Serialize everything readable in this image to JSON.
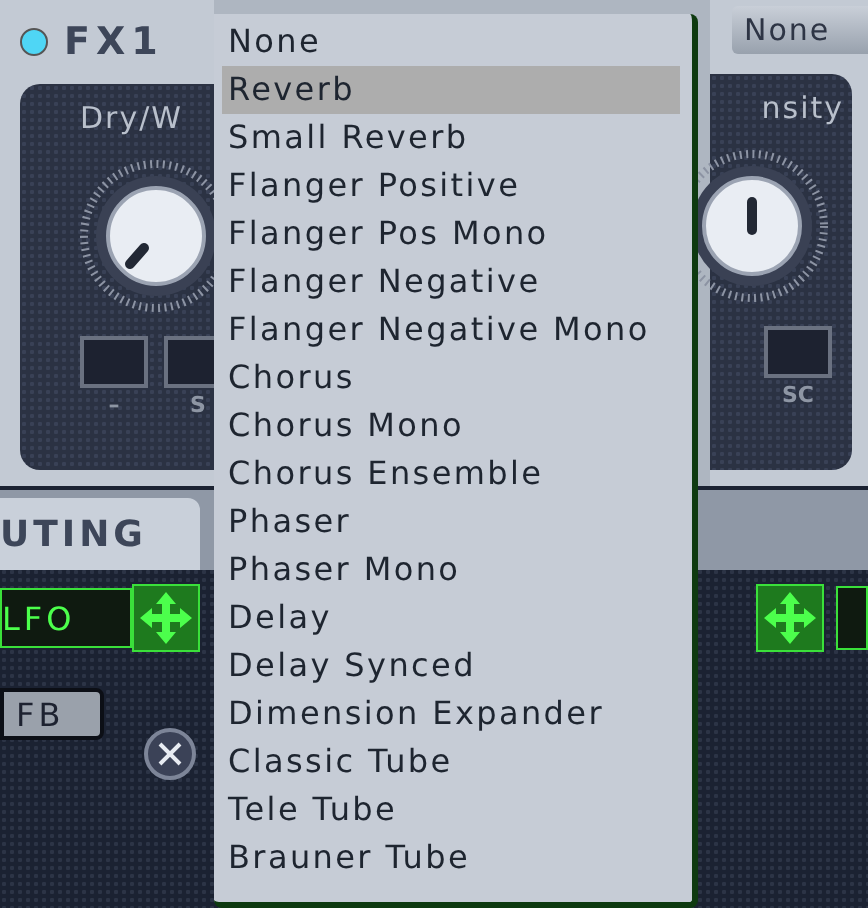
{
  "fx1": {
    "title": "FX1",
    "led_on": true,
    "knob_label": "Dry/W",
    "box_labels": [
      "–",
      "S"
    ]
  },
  "fx2": {
    "type_button": "None",
    "knob_label": "nsity",
    "box_labels": [
      "SC"
    ]
  },
  "tab": {
    "label": "UTING"
  },
  "routing": {
    "source": "LFO",
    "button": "FB"
  },
  "menu": {
    "items": [
      {
        "label": "None",
        "selected": false
      },
      {
        "label": "Reverb",
        "selected": true
      },
      {
        "label": "Small Reverb",
        "selected": false
      },
      {
        "label": "Flanger Positive",
        "selected": false
      },
      {
        "label": "Flanger Pos Mono",
        "selected": false
      },
      {
        "label": "Flanger Negative",
        "selected": false
      },
      {
        "label": "Flanger Negative Mono",
        "selected": false
      },
      {
        "label": "Chorus",
        "selected": false
      },
      {
        "label": "Chorus Mono",
        "selected": false
      },
      {
        "label": "Chorus Ensemble",
        "selected": false
      },
      {
        "label": "Phaser",
        "selected": false
      },
      {
        "label": "Phaser Mono",
        "selected": false
      },
      {
        "label": "Delay",
        "selected": false
      },
      {
        "label": "Delay Synced",
        "selected": false
      },
      {
        "label": "Dimension Expander",
        "selected": false
      },
      {
        "label": "Classic Tube",
        "selected": false
      },
      {
        "label": "Tele Tube",
        "selected": false
      },
      {
        "label": "Brauner Tube",
        "selected": false
      }
    ]
  }
}
